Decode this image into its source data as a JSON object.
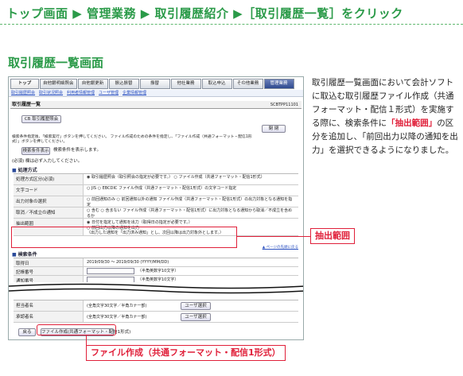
{
  "breadcrumb": {
    "text": "トップ画面 ▶ 管理業務 ▶ 取引履歴紹介 ▶［取引履歴一覧］をクリック"
  },
  "section_title": "取引履歴一覧画面",
  "screen": {
    "tabs": [
      "トップ",
      "自他銀明細照会",
      "自他銀更新",
      "振込振替",
      "振替",
      "他社業務",
      "取込申込",
      "その他業務",
      "管理業務"
    ],
    "subnav": [
      "取引履歴照会",
      "取引状況照会",
      "利用者情報管理",
      "ユーザ管理",
      "企業情報管理"
    ],
    "page_title": "取引履歴一覧",
    "page_id": "SCBTPP11101",
    "btn_cb": "CB 取引履歴照会",
    "btn_close": "閉 閉",
    "notice": "検索条件指定後、「検索実行」ボタンを押してください。 ファイル作成のための条件を指定し、「ファイル作成（共通フォーマット・配信1形式）」ボタンを押してください。",
    "btn_search_exec": "検索条件表示",
    "btn_search_note": "検索条件を表示します。",
    "required_note": "(必須) 欄は必ず入力してください。",
    "sec_process": "処理方式",
    "rows": [
      {
        "label": "処理方式区分(必須)",
        "value": "◉ 取引履歴照会（取引照会の指定が必要です。） ○ ファイル作成（共通フォーマット・配信1形式）"
      },
      {
        "label": "文字コード",
        "value": "○ JIS ○ EBCDIC ファイル作成（共通フォーマット・配信1形式）の文字コード指定"
      },
      {
        "label": "出力対象の選択",
        "value": "○ 前回通知のみ ○ 前回通知以外の通知 ファイル作成（共通フォーマット・配信1形式）の出力対象となる通知を指定"
      },
      {
        "label": "取消／不成立の通知",
        "value": "○ 含む ○ 含まない ファイル作成（共通フォーマット・配信1形式）に出力対象となる通知から取消／不成立を含めるか"
      }
    ],
    "extract_label": "抽出範囲",
    "extract_opt1": "◉ 日付を指定して通知を出力（取得日の指定が必要です。）",
    "extract_opt2": "○ 前回出力以降の通知を出力",
    "extract_opt3": "（出力した通知を「出力済み通知」とし、次回以降は出力対象外とします。）",
    "page_top": "▲ ページの先頭に戻る",
    "sec_search": "検索条件",
    "search_rows": [
      {
        "label": "取得日",
        "value": "2019/09/30 ～ 2019/09/30 (YYYY/MM/DD)"
      },
      {
        "label": "記帳番号",
        "value": "（半角英数字10文字）"
      },
      {
        "label": "通知番号",
        "value": "（半角英数字10文字）"
      }
    ],
    "approver_rows": [
      {
        "label": "担当者名",
        "value": "(全角文字30文字／半角カナ一部)"
      },
      {
        "label": "承認者名",
        "value": "(全角文字30文字／半角カナ一部)"
      }
    ],
    "btn_user_select": "ユーザ選択",
    "btn_back": "戻る",
    "btn_file_create": "ファイル作成(共通フォーマット・配信1形式)"
  },
  "callout_extract": "抽出範囲",
  "callout_file": "ファイル作成（共通フォーマット・配信1形式）",
  "description": {
    "part1": "取引履歴一覧画面において会計ソフトに取込む取引履歴ファイル作成（共通フォーマット・配信１形式）を実施する際に、検索条件に",
    "highlight": "「抽出範囲」",
    "part2": "の区分を追加し、「前回出力以降の通知を出力」を選択できるようになりました。"
  },
  "colors": {
    "accent_green": "#2a9a48",
    "callout_red": "#e0203a",
    "tab_active": "#2f4a90"
  }
}
